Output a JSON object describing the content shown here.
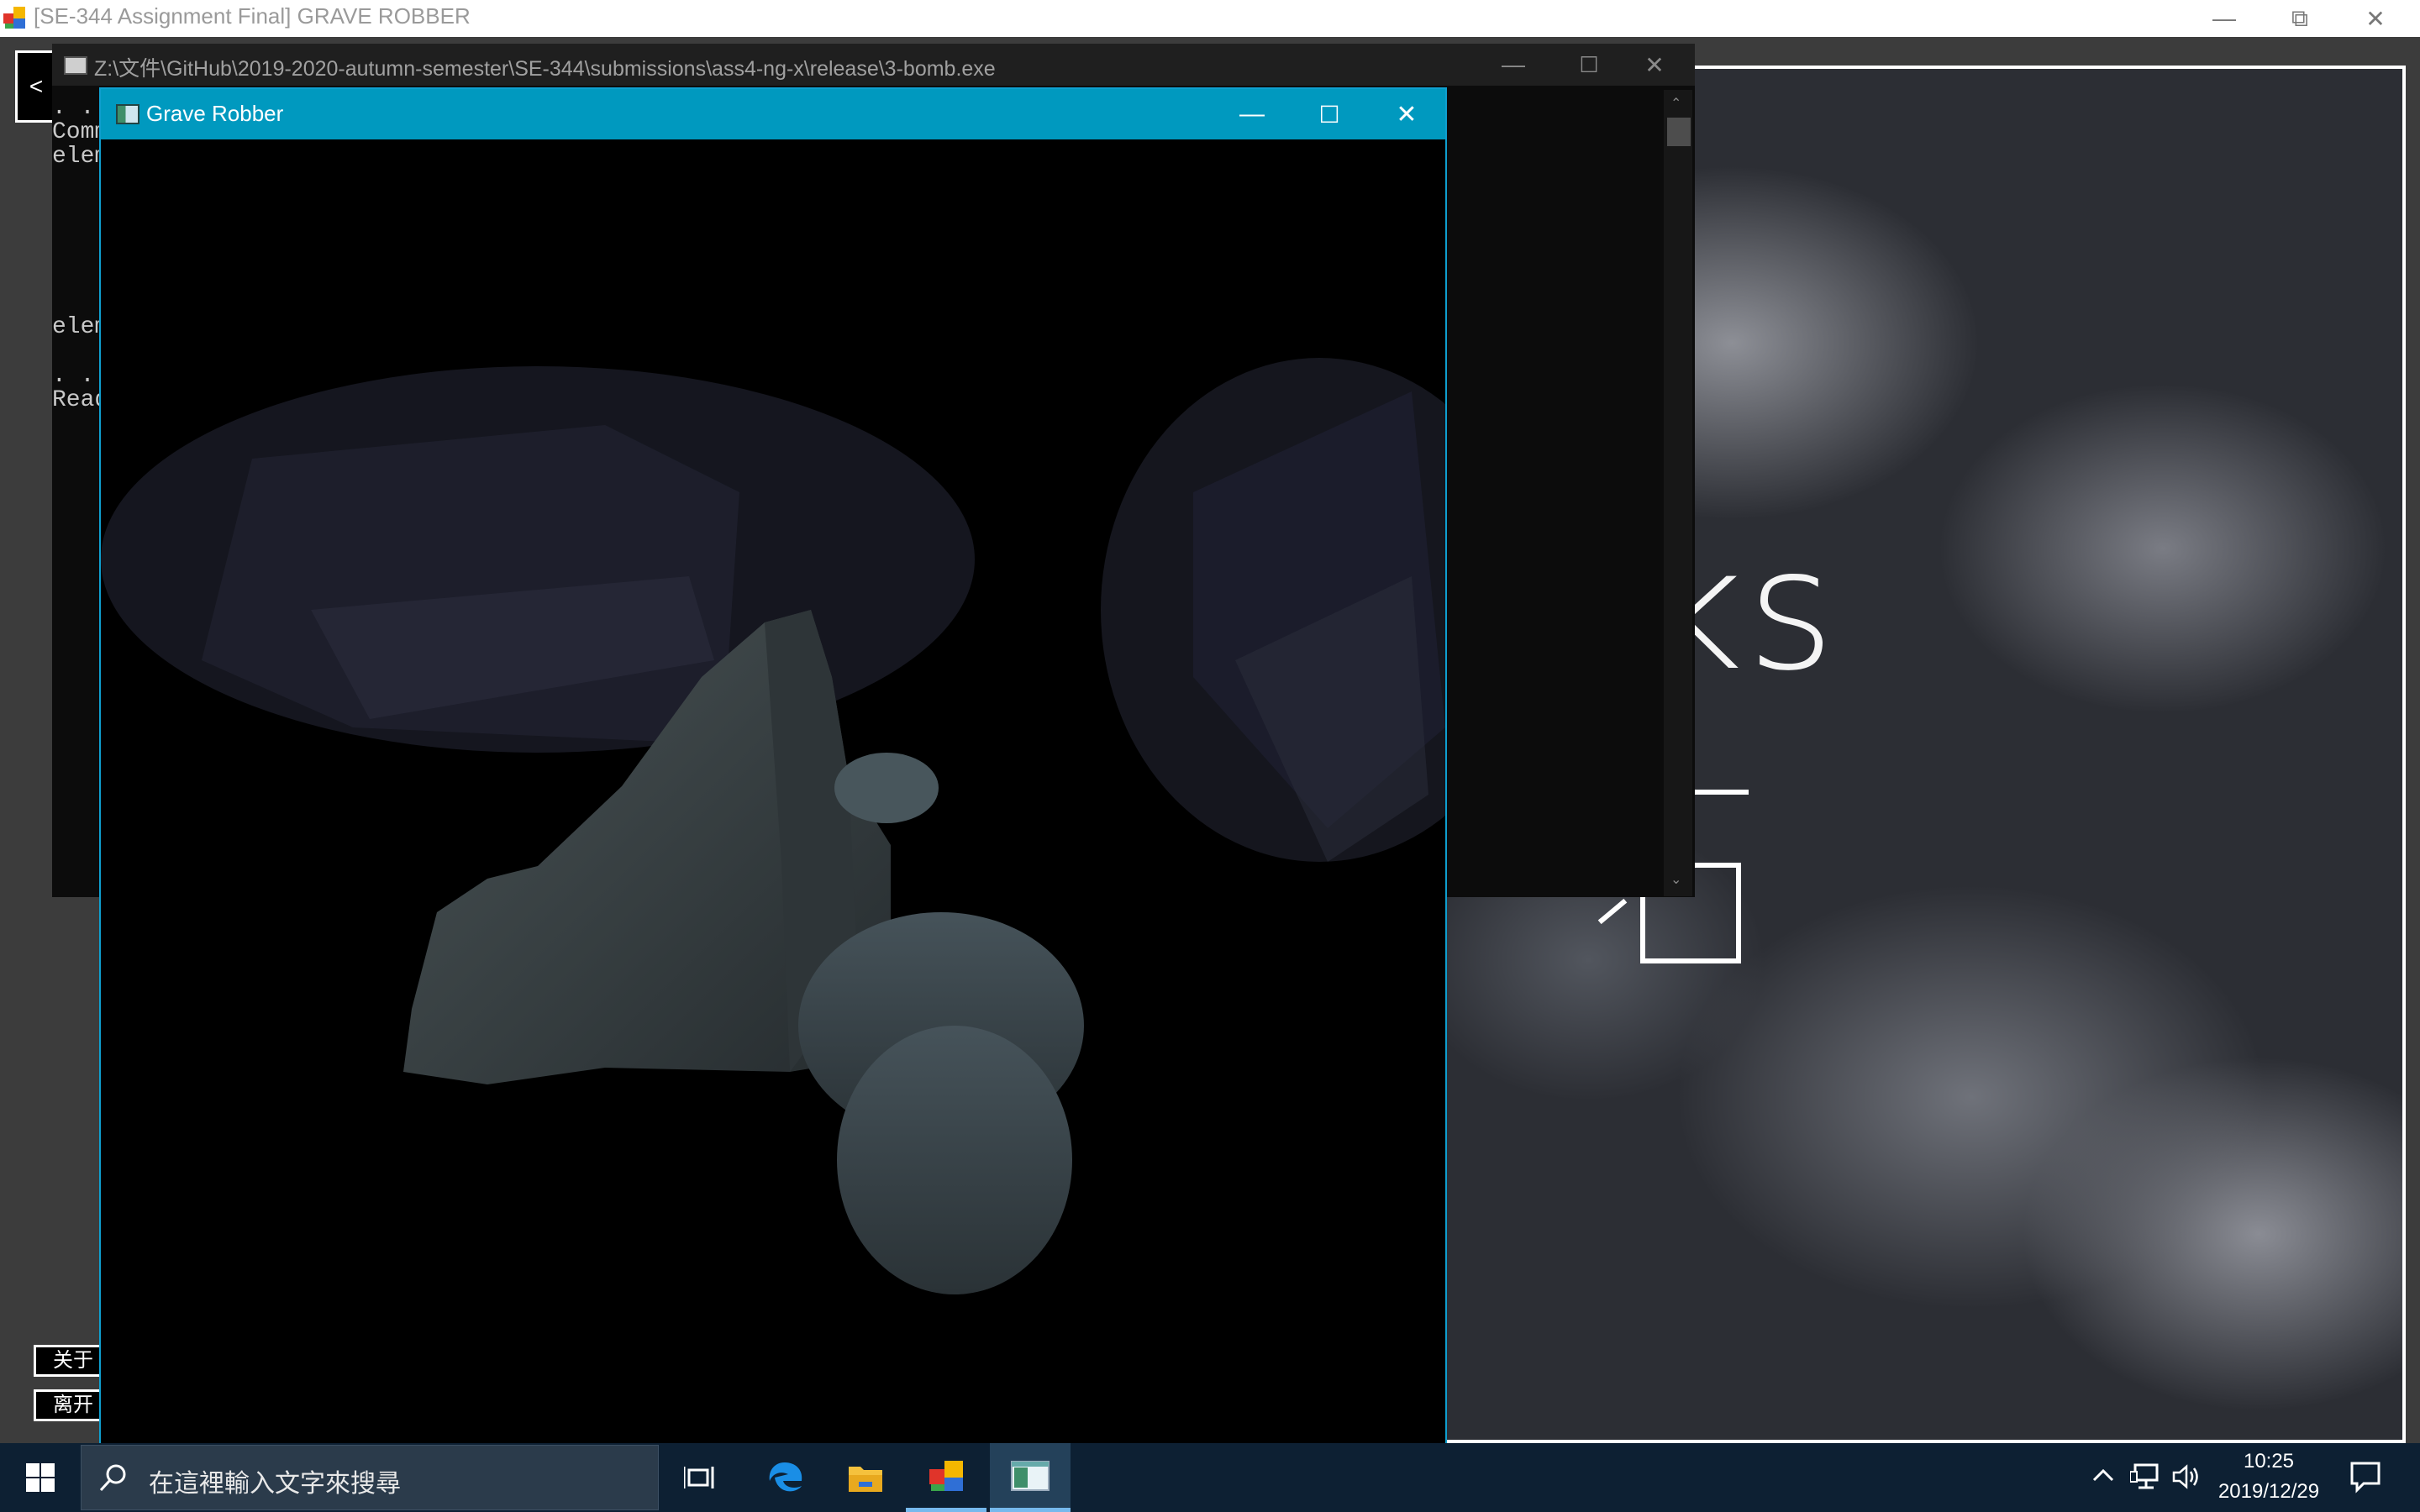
{
  "outer_window": {
    "title": "[SE-344 Assignment Final] GRAVE ROBBER",
    "back_label": "<",
    "side_buttons": [
      "关于",
      "离开"
    ],
    "panel_text": "ocks"
  },
  "console_window": {
    "title": "Z:\\文件\\GitHub\\2019-2020-autumn-semester\\SE-344\\submissions\\ass4-ng-x\\release\\3-bomb.exe",
    "lines": [
      ". . . .",
      "Comm",
      "elem",
      "",
      "",
      "",
      "",
      "",
      "",
      "elem",
      "",
      ". . . .",
      "Read"
    ]
  },
  "game_window": {
    "title": "Grave Robber"
  },
  "taskbar": {
    "search_placeholder": "在這裡輸入文字來搜尋",
    "time": "10:25",
    "date": "2019/12/29"
  },
  "colors": {
    "game_titlebar": "#0099bf",
    "taskbar": "#0d2033",
    "console_bg": "#0c0c0c"
  }
}
